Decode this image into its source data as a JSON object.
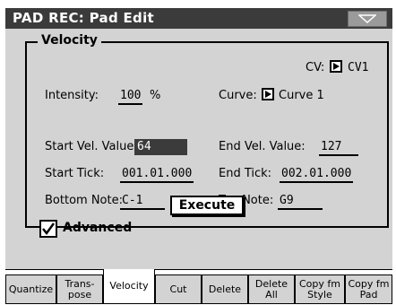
{
  "window": {
    "title": "PAD REC: Pad Edit"
  },
  "velocity_section": {
    "title": "Velocity",
    "cv_label": "CV:",
    "cv_value": "CV1",
    "intensity_label": "Intensity:",
    "intensity_value": "100",
    "intensity_unit": "%",
    "curve_label": "Curve:",
    "curve_value": "Curve 1",
    "start_vel_label": "Start Vel. Value:",
    "start_vel_value": "64",
    "end_vel_label": "End Vel. Value:",
    "end_vel_value": "127",
    "start_tick_label": "Start Tick:",
    "start_tick_value": "001.01.000",
    "end_tick_label": "End Tick:",
    "end_tick_value": "002.01.000",
    "bottom_note_label": "Bottom Note:",
    "bottom_note_value": "C-1",
    "top_note_label": "Top Note:",
    "top_note_value": "G9"
  },
  "advanced": {
    "label": "Advanced",
    "checked": true
  },
  "execute_label": "Execute",
  "tabs": [
    {
      "label": "Quantize",
      "active": false
    },
    {
      "label": "Trans-\npose",
      "active": false
    },
    {
      "label": "Velocity",
      "active": true
    },
    {
      "label": "Cut",
      "active": false
    },
    {
      "label": "Delete",
      "active": false
    },
    {
      "label": "Delete\nAll",
      "active": false
    },
    {
      "label": "Copy fm\nStyle",
      "active": false
    },
    {
      "label": "Copy fm\nPad",
      "active": false
    }
  ],
  "colors": {
    "title_bar": "#3b3b3b",
    "panel": "#d3d3d3",
    "selected_field": "#3b3b3b"
  }
}
